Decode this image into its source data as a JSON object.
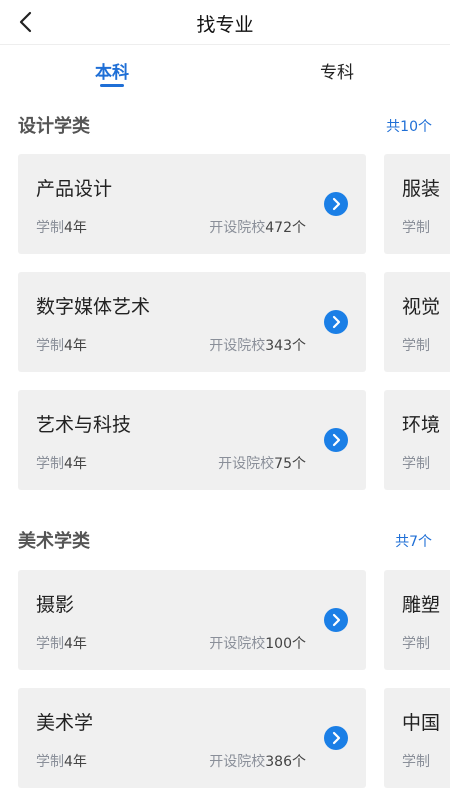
{
  "header": {
    "title": "找专业",
    "back_icon": "chevron-left-icon"
  },
  "tabs": [
    {
      "label": "本科",
      "active": true
    },
    {
      "label": "专科",
      "active": false
    }
  ],
  "sections": [
    {
      "title": "设计学类",
      "count": "共10个",
      "cards": [
        {
          "name": "产品设计",
          "duration_label": "学制",
          "duration": "4年",
          "schools_label": "开设院校",
          "schools": "472个"
        },
        {
          "name": "数字媒体艺术",
          "duration_label": "学制",
          "duration": "4年",
          "schools_label": "开设院校",
          "schools": "343个"
        },
        {
          "name": "艺术与科技",
          "duration_label": "学制",
          "duration": "4年",
          "schools_label": "开设院校",
          "schools": "75个"
        }
      ],
      "peeks": [
        {
          "name": "服装",
          "meta": "学制"
        },
        {
          "name": "视觉",
          "meta": "学制"
        },
        {
          "name": "环境",
          "meta": "学制"
        }
      ]
    },
    {
      "title": "美术学类",
      "count": "共7个",
      "cards": [
        {
          "name": "摄影",
          "duration_label": "学制",
          "duration": "4年",
          "schools_label": "开设院校",
          "schools": "100个"
        },
        {
          "name": "美术学",
          "duration_label": "学制",
          "duration": "4年",
          "schools_label": "开设院校",
          "schools": "386个"
        }
      ],
      "peeks": [
        {
          "name": "雕塑",
          "meta": "学制"
        },
        {
          "name": "中国",
          "meta": "学制"
        }
      ]
    }
  ],
  "colors": {
    "accent": "#1f6fd6",
    "arrow": "#1b7fe6",
    "card_bg": "#f0f0f0"
  }
}
